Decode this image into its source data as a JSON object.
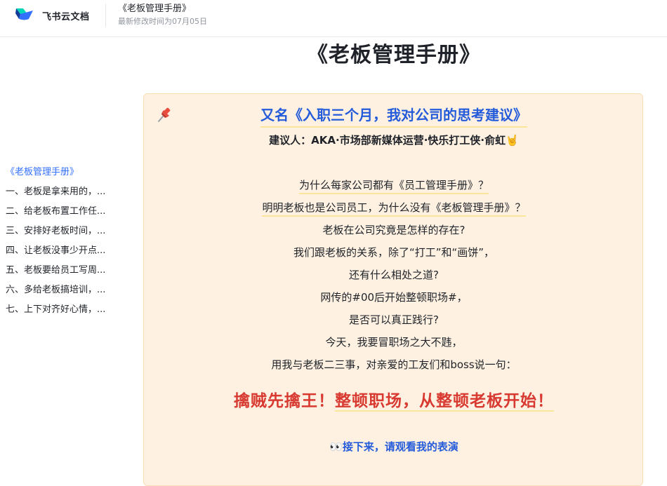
{
  "header": {
    "brand_name": "飞书云文档",
    "doc_title": "《老板管理手册》",
    "modified": "最新修改时间为07月05日"
  },
  "outline": {
    "items": [
      {
        "label": "《老板管理手册》",
        "active": true
      },
      {
        "label": "一、老板是拿来用的，...",
        "active": false
      },
      {
        "label": "二、给老板布置工作任...",
        "active": false
      },
      {
        "label": "三、安排好老板时间，...",
        "active": false
      },
      {
        "label": "四、让老板没事少开点...",
        "active": false
      },
      {
        "label": "五、老板要给员工写周...",
        "active": false
      },
      {
        "label": "六、多给老板搞培训，...",
        "active": false
      },
      {
        "label": "七、上下对齐好心情，...",
        "active": false
      }
    ]
  },
  "document": {
    "title": "《老板管理手册》",
    "callout": {
      "icon": "pushpin-icon",
      "subtitle": "又名《入职三个月，我对公司的思考建议》",
      "proposer": "建议人：AKA·市场部新媒体运营·快乐打工侠·俞虹",
      "proposer_emoji": "🤘",
      "lines": [
        "为什么每家公司都有《员工管理手册》？",
        "明明老板也是公司员工，为什么没有《老板管理手册》？",
        "老板在公司究竟是怎样的存在?",
        "我们跟老板的关系，除了“打工”和“画饼”，",
        "还有什么相处之道?",
        "网传的#00后开始整顿职场#，",
        "是否可以真正践行?",
        "今天，我要冒职场之大不韪，",
        "用我与老板二三事，对亲爱的工友们和boss说一句："
      ],
      "slogan_part1": "擒贼先擒王！",
      "slogan_part2": "整顿职场，从整顿老板开始！",
      "next_emoji": "👀",
      "next_text": "接下来，请观看我的表演"
    }
  },
  "colors": {
    "accent": "#3370ff",
    "link_blue": "#245bdb",
    "slogan_red": "#d83931",
    "callout_bg": "#fef1e1",
    "highlight_underline": "#fbe59b"
  }
}
